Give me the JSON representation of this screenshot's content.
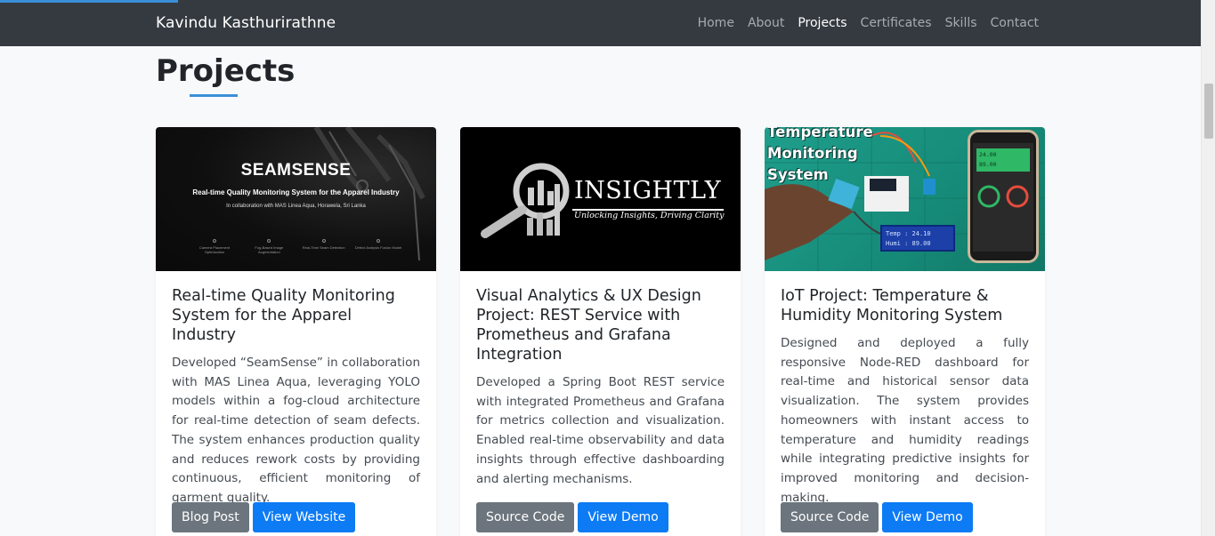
{
  "navbar": {
    "brand": "Kavindu Kasthurirathne",
    "links": [
      {
        "label": "Home",
        "active": false
      },
      {
        "label": "About",
        "active": false
      },
      {
        "label": "Projects",
        "active": true
      },
      {
        "label": "Certificates",
        "active": false
      },
      {
        "label": "Skills",
        "active": false
      },
      {
        "label": "Contact",
        "active": false
      }
    ]
  },
  "section": {
    "title": "Projects"
  },
  "colors": {
    "accent": "#3b8fd9",
    "navbar_bg": "#343a40",
    "btn_gray": "#6c757d",
    "btn_blue": "#0d7bf4"
  },
  "cards": [
    {
      "image": {
        "logo": "SEAMSENSE",
        "subtitle": "Real-time Quality Monitoring System for the Apparel Industry",
        "collab": "In collaboration with MAS Linea Aqua, Horawela, Sri Lanka",
        "features": [
          "Camera Placement Optimization",
          "Fog-Based Image Augmentation",
          "Real-Time Seam Detection",
          "Defect Analysis Fusion Model"
        ]
      },
      "title": "Real-time Quality Monitoring System for the Apparel Industry",
      "text": "Developed “SeamSense” in collaboration with MAS Linea Aqua, leveraging YOLO models within a fog-cloud architecture for real-time detection of seam defects. The system enhances production quality and reduces rework costs by providing continuous, efficient monitoring of garment quality.",
      "buttons": [
        "Blog Post",
        "View Website"
      ]
    },
    {
      "image": {
        "logo": "INSIGHTLY",
        "tagline": "Unlocking Insights, Driving Clarity"
      },
      "title": "Visual Analytics & UX Design Project: REST Service with Prometheus and Grafana Integration",
      "text": "Developed a Spring Boot REST service with integrated Prometheus and Grafana for metrics collection and visualization. Enabled real-time observability and data insights through effective dashboarding and alerting mechanisms.",
      "buttons": [
        "Source Code",
        "View Demo"
      ]
    },
    {
      "image": {
        "heading_lines": [
          "Temperature",
          "Monitoring",
          "System"
        ],
        "lcd_lines": [
          "Temp : 24.10",
          "Humi : 89.00"
        ],
        "phone_lines": [
          "24.00",
          "89.00"
        ]
      },
      "title": "IoT Project: Temperature & Humidity Monitoring System",
      "text": "Designed and deployed a fully responsive Node-RED dashboard for real-time and historical sensor data visualization. The system provides homeowners with instant access to temperature and humidity readings while integrating predictive insights for improved monitoring and decision-making.",
      "buttons": [
        "Source Code",
        "View Demo"
      ]
    }
  ]
}
